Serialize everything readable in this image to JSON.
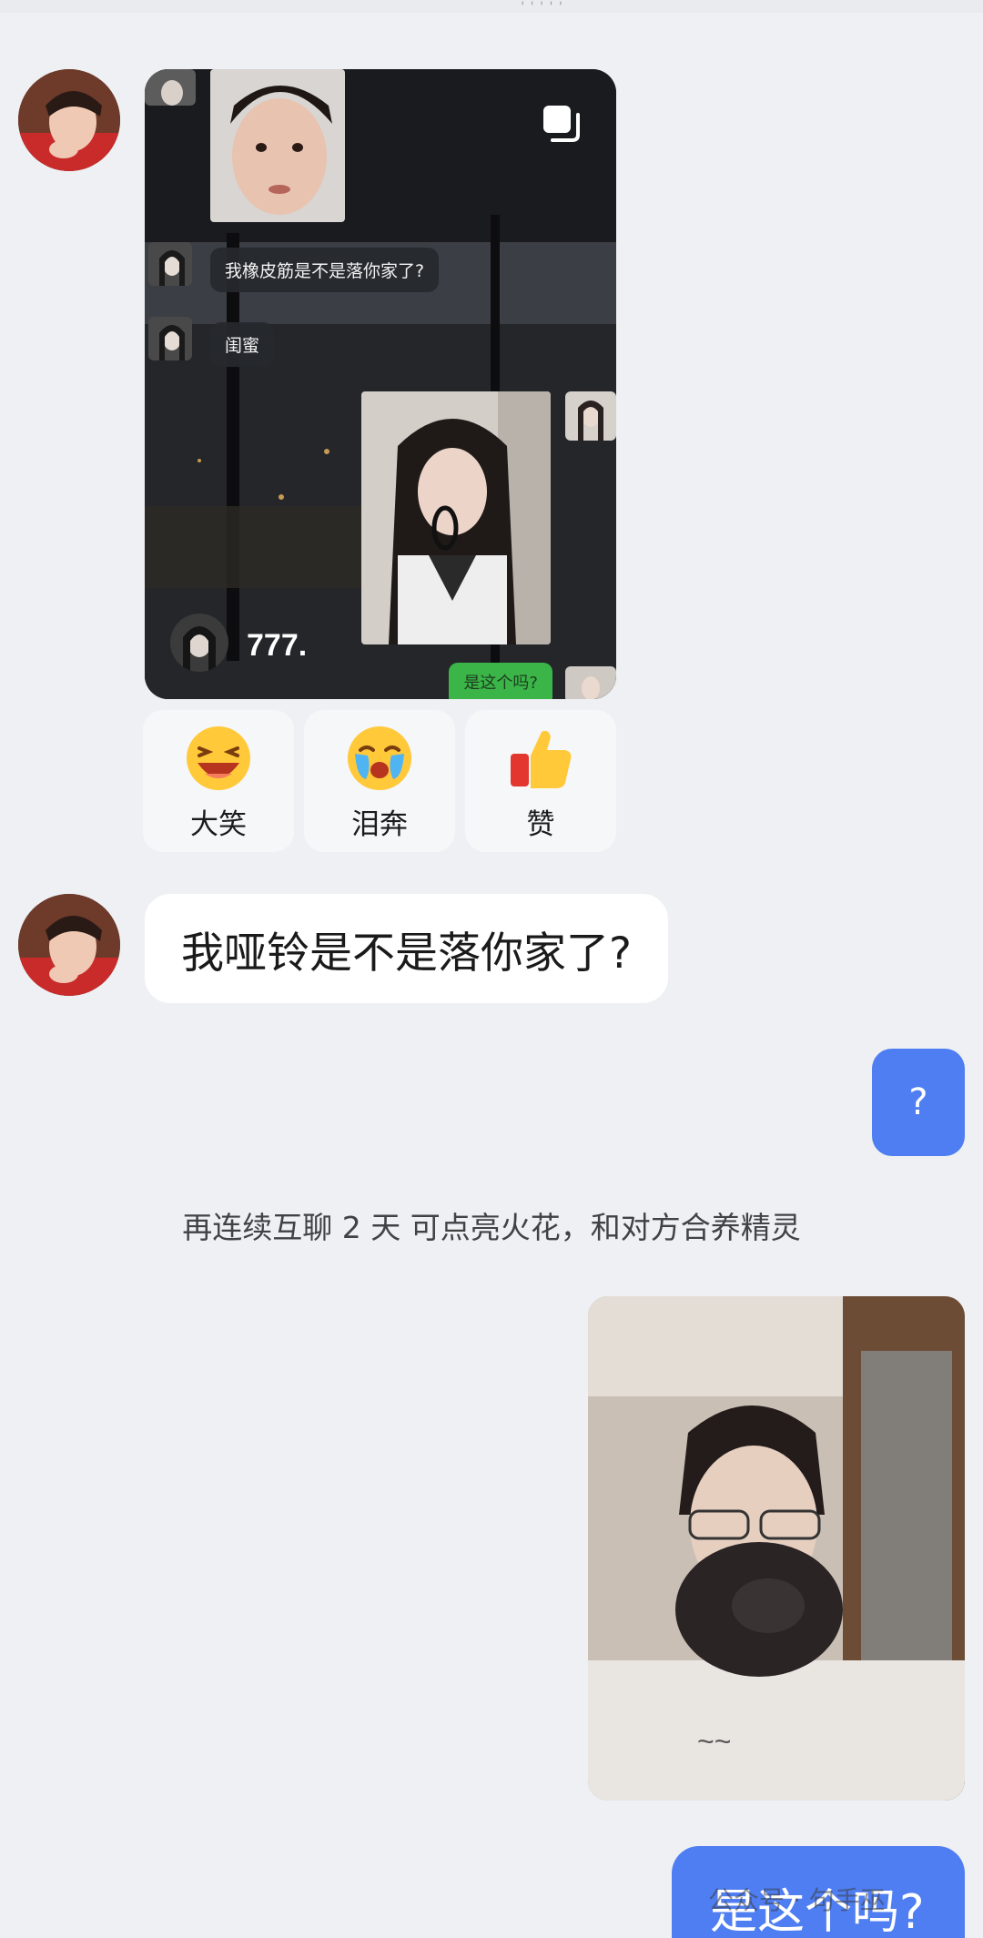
{
  "top_marks": "'''''",
  "shared_card": {
    "bubbles": [
      "我橡皮筋是不是落你家了?",
      "闺蜜"
    ],
    "caption": "777.",
    "green_bubble": "是这个吗?",
    "stack_icon": "multi-image-stack-icon"
  },
  "reactions": [
    {
      "label": "大笑",
      "icon": "laughing-face-icon"
    },
    {
      "label": "泪奔",
      "icon": "crying-face-icon"
    },
    {
      "label": "赞",
      "icon": "thumbs-up-icon"
    }
  ],
  "messages": {
    "incoming_text": "我哑铃是不是落你家了?",
    "outgoing_question": "?",
    "system_tip": "再连续互聊 2 天 可点亮火花，和对方合养精灵",
    "outgoing_last": "是这个吗?"
  },
  "watermark": "公众号 · 句手巫",
  "colors": {
    "outgoing_bubble": "#4f7ef3",
    "incoming_bubble": "#ffffff",
    "background": "#eef0f3"
  }
}
